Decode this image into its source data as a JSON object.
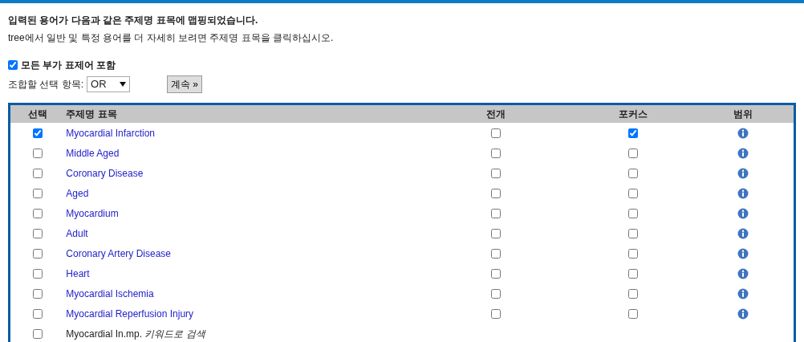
{
  "intro": {
    "heading": "입력된 용어가 다음과 같은 주제명 표목에 맵핑되었습니다.",
    "instruction": "tree에서 일반 및 특정 용어를 더 자세히 보려면 주제명 표목을 클릭하십시오."
  },
  "include_all": {
    "label": "모든 부가 표제어 포함",
    "checked": true
  },
  "combine": {
    "label": "조합할 선택 항목:",
    "value": "OR",
    "button": "계속 »"
  },
  "table": {
    "columns": [
      "선택",
      "주제명 표목",
      "전개",
      "포커스",
      "범위"
    ],
    "rows": [
      {
        "kind": "heading",
        "selected": true,
        "term": "Myocardial Infarction",
        "explode": false,
        "focus": true
      },
      {
        "kind": "heading",
        "selected": false,
        "term": "Middle Aged",
        "explode": false,
        "focus": false
      },
      {
        "kind": "heading",
        "selected": false,
        "term": "Coronary Disease",
        "explode": false,
        "focus": false
      },
      {
        "kind": "heading",
        "selected": false,
        "term": "Aged",
        "explode": false,
        "focus": false
      },
      {
        "kind": "heading",
        "selected": false,
        "term": "Myocardium",
        "explode": false,
        "focus": false
      },
      {
        "kind": "heading",
        "selected": false,
        "term": "Adult",
        "explode": false,
        "focus": false
      },
      {
        "kind": "heading",
        "selected": false,
        "term": "Coronary Artery Disease",
        "explode": false,
        "focus": false
      },
      {
        "kind": "heading",
        "selected": false,
        "term": "Heart",
        "explode": false,
        "focus": false
      },
      {
        "kind": "heading",
        "selected": false,
        "term": "Myocardial Ischemia",
        "explode": false,
        "focus": false
      },
      {
        "kind": "heading",
        "selected": false,
        "term": "Myocardial Reperfusion Injury",
        "explode": false,
        "focus": false
      },
      {
        "kind": "keyword",
        "selected": false,
        "term": "Myocardial In.mp. *키워드로 검색*"
      }
    ]
  }
}
